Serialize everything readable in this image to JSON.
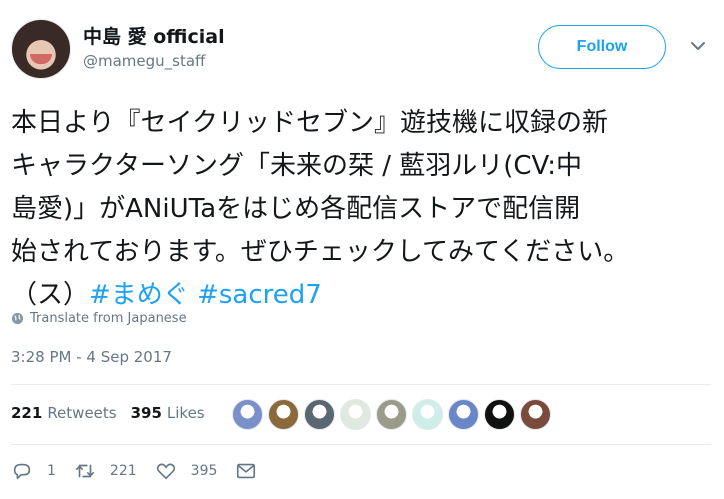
{
  "user": {
    "display_name": "中島 愛 official",
    "handle": "@mamegu_staff",
    "follow_label": "Follow"
  },
  "tweet": {
    "lines": [
      "本日より『セイクリッドセブン』遊技機に収録の新",
      "キャラクターソング「未来の栞 / 藍羽ルリ(CV:中",
      "島愛)」がANiUTaをはじめ各配信ストアで配信開",
      "始されております。ぜひチェックしてみてください。"
    ],
    "last_line_prefix": "（ス）",
    "hashtags": [
      "#まめぐ",
      "#sacred7"
    ],
    "translate_label": "Translate from Japanese",
    "timestamp": "3:28 PM - 4 Sep 2017"
  },
  "stats": {
    "retweets_count": "221",
    "retweets_label": "Retweets",
    "likes_count": "395",
    "likes_label": "Likes"
  },
  "likers": [
    {
      "icon": "liker-avatar-1",
      "color": "#7b8fc9"
    },
    {
      "icon": "liker-avatar-2",
      "color": "#8a6a3a"
    },
    {
      "icon": "liker-avatar-3",
      "color": "#5a6670"
    },
    {
      "icon": "liker-avatar-4",
      "color": "#dfe9df"
    },
    {
      "icon": "liker-avatar-5",
      "color": "#9b9b8a"
    },
    {
      "icon": "liker-avatar-6",
      "color": "#cfeee9"
    },
    {
      "icon": "liker-avatar-7",
      "color": "#6a86c8"
    },
    {
      "icon": "liker-avatar-8",
      "color": "#111111"
    },
    {
      "icon": "liker-avatar-9",
      "color": "#7a4a3a"
    }
  ],
  "actions": {
    "reply_count": "1",
    "retweet_count": "221",
    "like_count": "395"
  },
  "colors": {
    "accent": "#1da1f2",
    "secondary_text": "#657786",
    "primary_text": "#14171a"
  }
}
